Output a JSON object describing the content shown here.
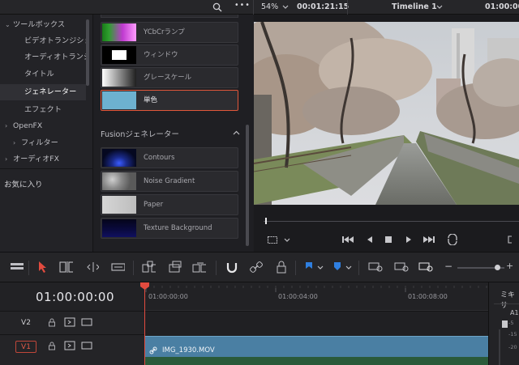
{
  "topbar": {
    "zoom": "54%",
    "timecode": "00:01:21:15",
    "timeline_name": "Timeline 1",
    "timecode_right": "01:00:00"
  },
  "toolbox": {
    "items": [
      {
        "label": "ツールボックス",
        "expandable": true,
        "level": 0
      },
      {
        "label": "ビデオトランジション",
        "level": 1
      },
      {
        "label": "オーディオトランジ...",
        "level": 1
      },
      {
        "label": "タイトル",
        "level": 1
      },
      {
        "label": "ジェネレーター",
        "level": 1,
        "selected": true
      },
      {
        "label": "エフェクト",
        "level": 1
      },
      {
        "label": "OpenFX",
        "expandable": true,
        "level": 0
      },
      {
        "label": "フィルター",
        "expandable": true,
        "level": 1
      },
      {
        "label": "オーディオFX",
        "expandable": true,
        "level": 0
      }
    ],
    "favorites": "お気に入り"
  },
  "generators": {
    "items": [
      {
        "label": "YCbCrランプ",
        "thumb": "ycbcr"
      },
      {
        "label": "ウィンドウ",
        "thumb": "window"
      },
      {
        "label": "グレースケール",
        "thumb": "grayscale"
      },
      {
        "label": "単色",
        "thumb": "solid",
        "selected": true
      }
    ],
    "fusion_header": "Fusionジェネレーター",
    "fusion_items": [
      {
        "label": "Contours",
        "thumb": "contours"
      },
      {
        "label": "Noise Gradient",
        "thumb": "noise"
      },
      {
        "label": "Paper",
        "thumb": "paper"
      },
      {
        "label": "Texture Background",
        "thumb": "texture"
      }
    ]
  },
  "timeline": {
    "timecode": "01:00:00:00",
    "ruler": [
      "01:00:00:00",
      "01:00:04:00",
      "01:00:08:00"
    ],
    "tracks": [
      {
        "name": "V2"
      },
      {
        "name": "V1"
      }
    ],
    "clip": "IMG_1930.MOV",
    "mixer_label": "ミキサ",
    "mixer_track": "A1",
    "mixer_scale": [
      "-5",
      "-15",
      "-20"
    ]
  },
  "colors": {
    "accent_red": "#e24b3f",
    "clip_blue": "#4a7fa3",
    "solid_color": "#6db1cf"
  }
}
